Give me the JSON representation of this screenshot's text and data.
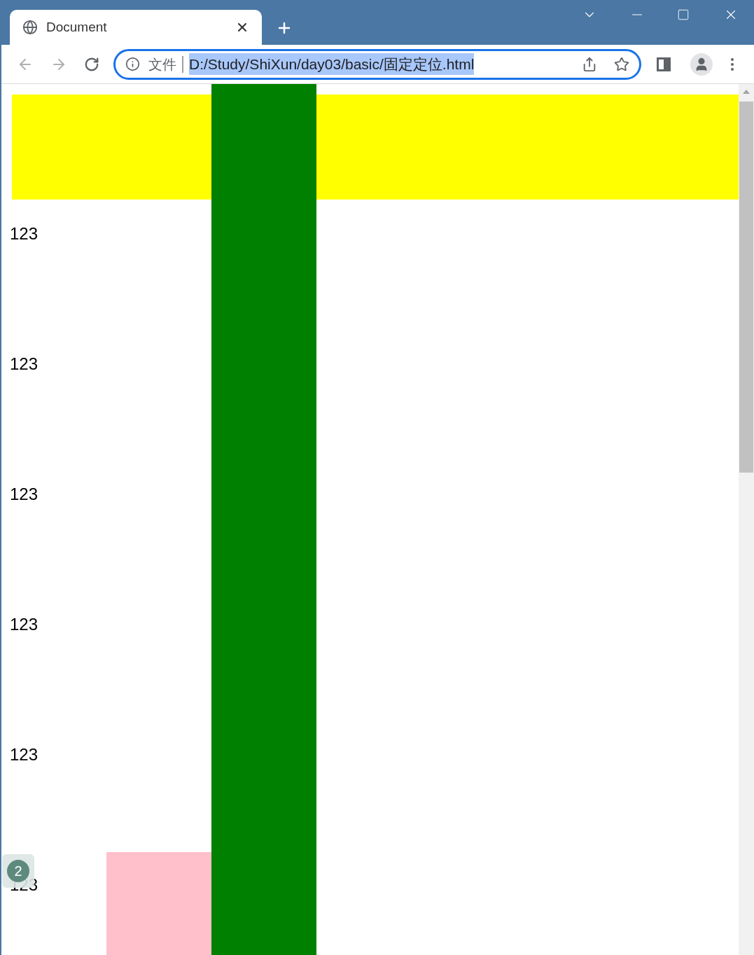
{
  "tab": {
    "title": "Document",
    "selected": true
  },
  "address_bar": {
    "scheme_label": "文件",
    "url": "D:/Study/ShiXun/day03/basic/固定定位.html",
    "selected": true
  },
  "page": {
    "lines": [
      "123",
      "123",
      "123",
      "123",
      "123",
      "123"
    ]
  },
  "badge": {
    "count": "2"
  }
}
